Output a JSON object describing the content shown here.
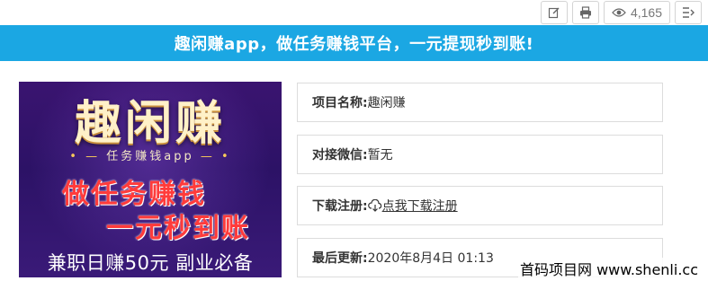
{
  "toolbar": {
    "view_count": "4,165",
    "icons": [
      "edit-icon",
      "print-icon",
      "eye-icon",
      "list-arrow-icon"
    ]
  },
  "banner": {
    "text": "趣闲赚app，做任务赚钱平台，一元提现秒到账!"
  },
  "poster": {
    "title": "趣闲赚",
    "subtitle": "任务赚钱app",
    "line1": "做任务赚钱",
    "line2": "一元秒到账",
    "bottom": "兼职日赚50元 副业必备"
  },
  "info": {
    "name_label": "项目名称:",
    "name_value": "趣闲赚",
    "wechat_label": "对接微信:",
    "wechat_value": "暂无",
    "download_label": "下载注册:",
    "download_value": "点我下载注册",
    "updated_label": "最后更新:",
    "updated_value": "2020年8月4日 01:13"
  },
  "watermark": "首码项目网 www.shenli.cc",
  "colors": {
    "banner": "#1ba7e3",
    "poster_bg": "#2c1266",
    "poster_red": "#ff3b3b",
    "poster_gold": "#fff1c8"
  }
}
